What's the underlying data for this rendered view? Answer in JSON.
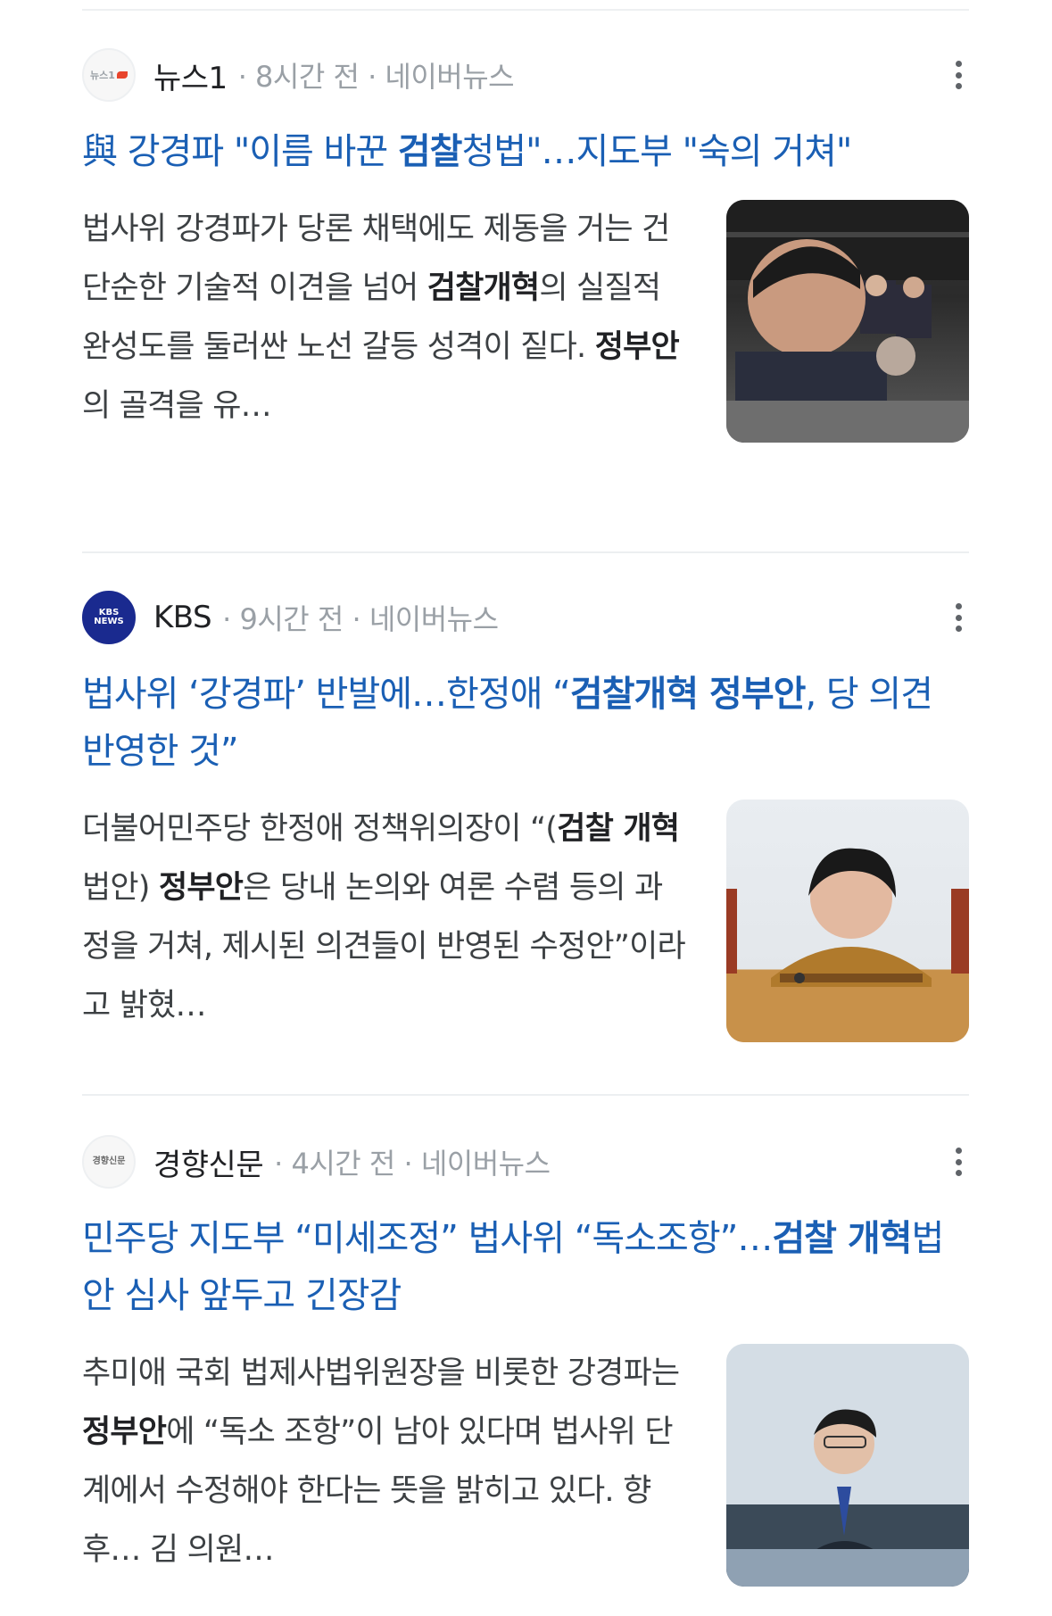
{
  "articles": [
    {
      "source": "뉴스1",
      "logo_text": "뉴스1",
      "time": "· 8시간 전 · 네이버뉴스",
      "headline": [
        {
          "t": "與 강경파 \"이름 바꾼 ",
          "b": false
        },
        {
          "t": "검찰",
          "b": true
        },
        {
          "t": "청법\"…지도부 \"숙의 거쳐\"",
          "b": false
        }
      ],
      "snippet": [
        {
          "t": "법사위 강경파가 당론 채택에도 제동을 거는 건 단순한 기술적 이견을 넘어 ",
          "b": false
        },
        {
          "t": "검찰개혁",
          "b": true
        },
        {
          "t": "의 실질적 완성도를 둘러싼 노선 갈등 성격이 짙다. ",
          "b": false
        },
        {
          "t": "정부안",
          "b": true
        },
        {
          "t": "의 골격을 유…",
          "b": false
        }
      ],
      "thumb_icon": "politician-photo"
    },
    {
      "source": "KBS",
      "logo_text": "KBS NEWS",
      "time": "· 9시간 전 · 네이버뉴스",
      "headline": [
        {
          "t": "법사위 ‘강경파’ 반발에…한정애 “",
          "b": false
        },
        {
          "t": "검찰개혁 정부안",
          "b": true
        },
        {
          "t": ", 당 의견 반영한 것”",
          "b": false
        }
      ],
      "snippet": [
        {
          "t": "더불어민주당 한정애 정책위의장이 “(",
          "b": false
        },
        {
          "t": "검찰 개혁",
          "b": true
        },
        {
          "t": " 법안) ",
          "b": false
        },
        {
          "t": "정부안",
          "b": true
        },
        {
          "t": "은 당내 논의와 여론 수렴 등의 과정을 거쳐, 제시된 의견들이 반영된 수정안”이라고 밝혔…",
          "b": false
        }
      ],
      "thumb_icon": "speaker-photo"
    },
    {
      "source": "경향신문",
      "logo_text": "경향신문",
      "time": "· 4시간 전 · 네이버뉴스",
      "headline": [
        {
          "t": "민주당 지도부 “미세조정” 법사위 “독소조항”…",
          "b": false
        },
        {
          "t": "검찰 개혁",
          "b": true
        },
        {
          "t": "법안 심사 앞두고 긴장감",
          "b": false
        }
      ],
      "snippet": [
        {
          "t": "추미애 국회 법제사법위원장을 비롯한 강경파는 ",
          "b": false
        },
        {
          "t": "정부안",
          "b": true
        },
        {
          "t": "에 “독소 조항”이 남아 있다며 법사위 단계에서 수정해야 한다는 뜻을 밝히고 있다. 향후… 김 의원…",
          "b": false
        }
      ],
      "thumb_icon": "official-photo"
    }
  ]
}
